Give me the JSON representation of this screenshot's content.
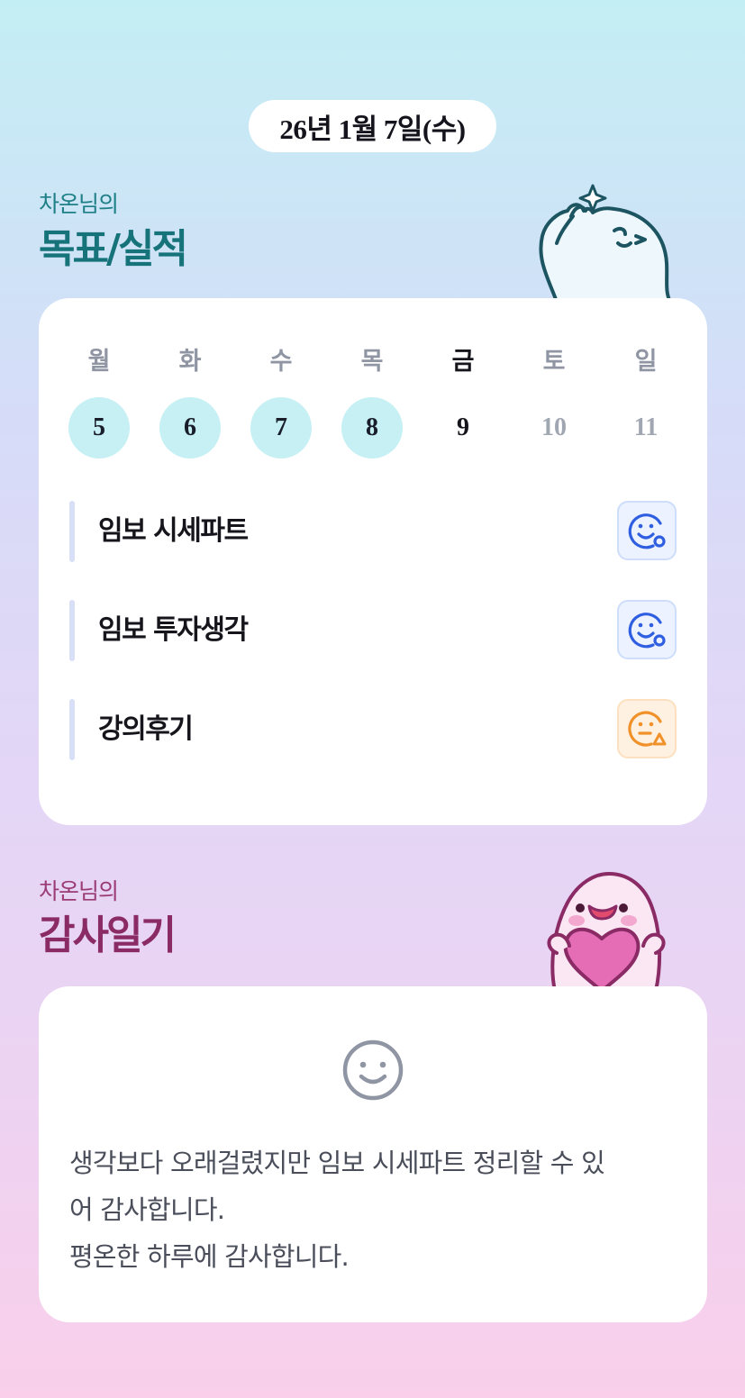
{
  "header": {
    "date": "26년 1월 7일(수)"
  },
  "goals": {
    "subtitle": "차온님의",
    "title": "목표/실적",
    "weekdays": [
      "월",
      "화",
      "수",
      "목",
      "금",
      "토",
      "일"
    ],
    "dates": [
      "5",
      "6",
      "7",
      "8",
      "9",
      "10",
      "11"
    ],
    "items": [
      {
        "label": "임보 시세파트",
        "status_icon": "smile-icon"
      },
      {
        "label": "임보 투자생각",
        "status_icon": "smile-icon"
      },
      {
        "label": "강의후기",
        "status_icon": "neutral-warning-icon"
      }
    ]
  },
  "thanks": {
    "subtitle": "차온님의",
    "title": "감사일기",
    "mood_icon": "smile-icon",
    "lines": [
      "생각보다 오래걸렸지만 임보 시세파트 정리할 수 있",
      "어 감사합니다.",
      "평온한 하루에 감사합니다."
    ]
  },
  "colors": {
    "goals_title": "#16737a",
    "thanks_title": "#8b2b65",
    "done_date": "#c6f0f4",
    "good_status": "#2f5fe0",
    "meh_status": "#f0912a"
  }
}
